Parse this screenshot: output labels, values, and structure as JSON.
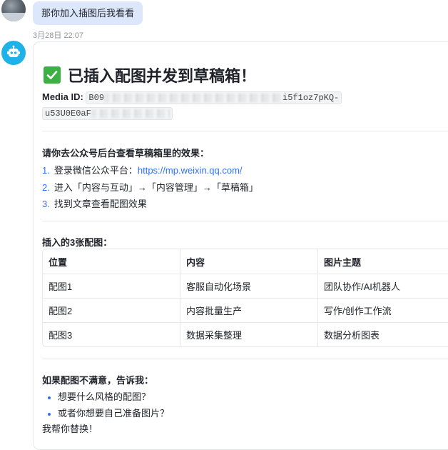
{
  "user_message": {
    "text": "那你加入插图后我看看",
    "timestamp": "3月28日 22:07"
  },
  "bot_message": {
    "title": "已插入配图并发到草稿箱！",
    "media_id_label": "Media ID",
    "media_id_visible_start": "B09",
    "media_id_visible_mid": "i5f1oz7pKQ-",
    "media_id_line2_visible": "u53U0E0aF",
    "instructions_heading": "请你去公众号后台查看草稿箱里的效果：",
    "steps": [
      {
        "num": "1.",
        "text": "登录微信公众平台：",
        "link": "https://mp.weixin.qq.com/"
      },
      {
        "num": "2.",
        "text": "进入「内容与互动」→「内容管理」→「草稿箱」"
      },
      {
        "num": "3.",
        "text": "找到文章查看配图效果"
      }
    ],
    "table_heading": "插入的3张配图：",
    "table": {
      "headers": [
        "位置",
        "内容",
        "图片主题"
      ],
      "rows": [
        [
          "配图1",
          "客服自动化场景",
          "团队协作/AI机器人"
        ],
        [
          "配图2",
          "内容批量生产",
          "写作/创作工作流"
        ],
        [
          "配图3",
          "数据采集整理",
          "数据分析图表"
        ]
      ]
    },
    "feedback_heading": "如果配图不满意，告诉我：",
    "feedback_bullets": [
      "想要什么风格的配图？",
      "或者你想要自己准备图片？"
    ],
    "closing": "我帮你替换！"
  },
  "colors": {
    "user_bubble": "#dce7fb",
    "bot_avatar": "#1fb2e8",
    "accent": "#3370ff",
    "check": "#3cb043"
  }
}
